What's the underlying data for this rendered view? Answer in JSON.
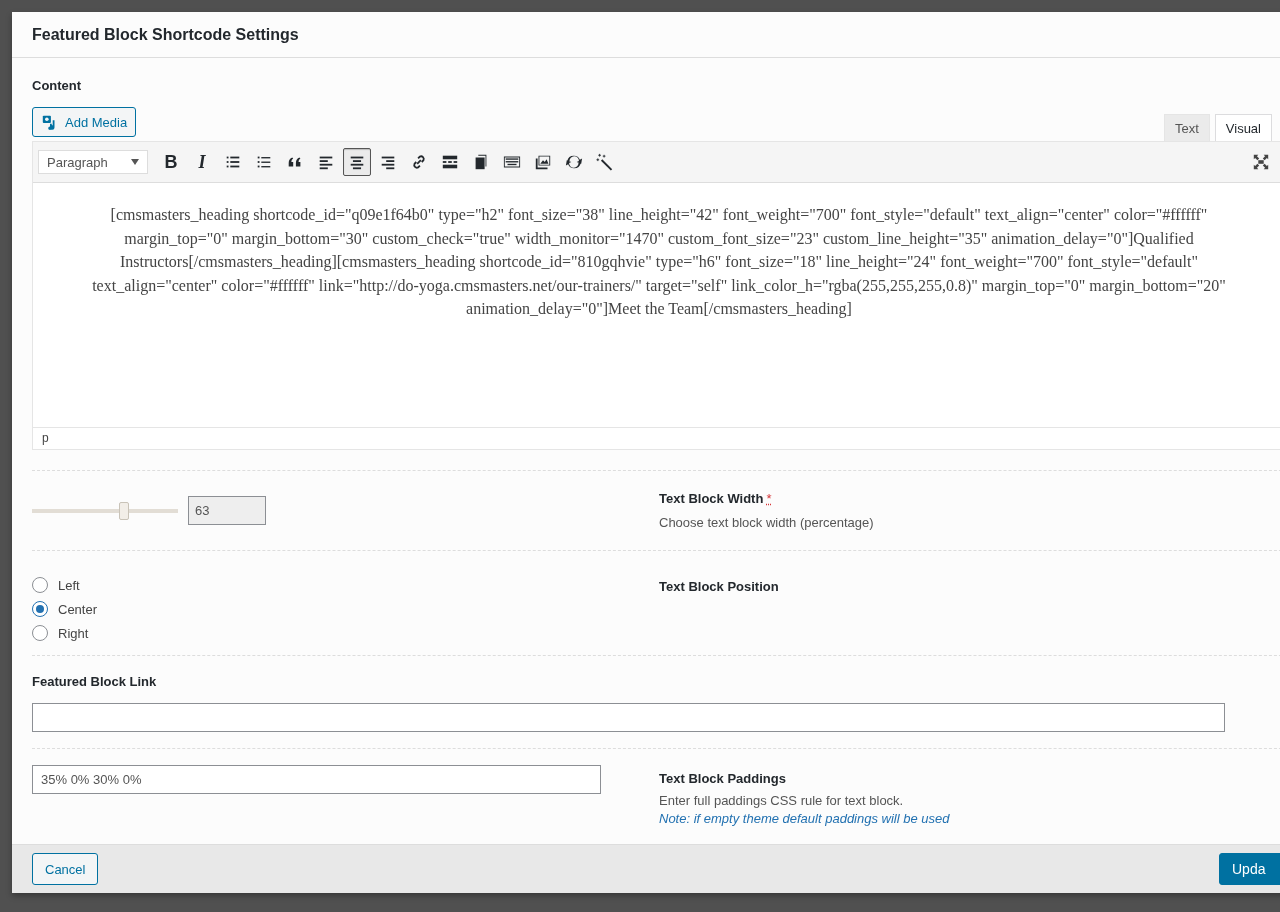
{
  "dialog": {
    "title": "Featured Block Shortcode Settings"
  },
  "content": {
    "label": "Content",
    "add_media": "Add Media",
    "editor_tabs": [
      {
        "label": "Text",
        "selected": false
      },
      {
        "label": "Visual",
        "selected": true
      }
    ],
    "format_select": "Paragraph",
    "toolbar": [
      {
        "kind": "bold",
        "label": "B",
        "active": false
      },
      {
        "kind": "italic",
        "label": "I",
        "active": false
      },
      {
        "kind": "bullet-list",
        "active": false
      },
      {
        "kind": "numbered-list",
        "active": false
      },
      {
        "kind": "quote",
        "active": false
      },
      {
        "kind": "align-left",
        "active": false
      },
      {
        "kind": "align-center",
        "active": true
      },
      {
        "kind": "align-right",
        "active": false
      },
      {
        "kind": "link",
        "active": false
      },
      {
        "kind": "read-more",
        "active": false
      },
      {
        "kind": "pages",
        "active": false
      },
      {
        "kind": "keyboard",
        "active": false
      },
      {
        "kind": "gallery",
        "active": false
      },
      {
        "kind": "refresh",
        "active": false
      },
      {
        "kind": "wand",
        "active": false
      }
    ],
    "text": "[cmsmasters_heading shortcode_id=\"q09e1f64b0\" type=\"h2\" font_size=\"38\" line_height=\"42\" font_weight=\"700\" font_style=\"default\" text_align=\"center\" color=\"#ffffff\" margin_top=\"0\" margin_bottom=\"30\" custom_check=\"true\" width_monitor=\"1470\" custom_font_size=\"23\" custom_line_height=\"35\" animation_delay=\"0\"]Qualified Instructors[/cmsmasters_heading][cmsmasters_heading shortcode_id=\"810gqhvie\" type=\"h6\" font_size=\"18\" line_height=\"24\" font_weight=\"700\" font_style=\"default\" text_align=\"center\" color=\"#ffffff\" link=\"http://do-yoga.cmsmasters.net/our-trainers/\" target=\"self\" link_color_h=\"rgba(255,255,255,0.8)\" margin_top=\"0\" margin_bottom=\"20\" animation_delay=\"0\"]Meet the Team[/cmsmasters_heading]",
    "path": "p"
  },
  "width": {
    "level": 0.63,
    "value": "63",
    "label": "Text Block Width",
    "required": "*",
    "description": "Choose text block width (percentage)"
  },
  "position": {
    "label": "Text Block Position",
    "options": [
      {
        "label": "Left",
        "selected": false
      },
      {
        "label": "Center",
        "selected": true
      },
      {
        "label": "Right",
        "selected": false
      }
    ]
  },
  "link": {
    "label": "Featured Block Link"
  },
  "paddings": {
    "value": "35% 0% 30% 0%",
    "label": "Text Block Paddings",
    "description": "Enter full paddings CSS rule for text block.",
    "note": "Note: if empty theme default paddings will be used"
  },
  "footer": {
    "cancel": "Cancel",
    "update": "Upda"
  }
}
